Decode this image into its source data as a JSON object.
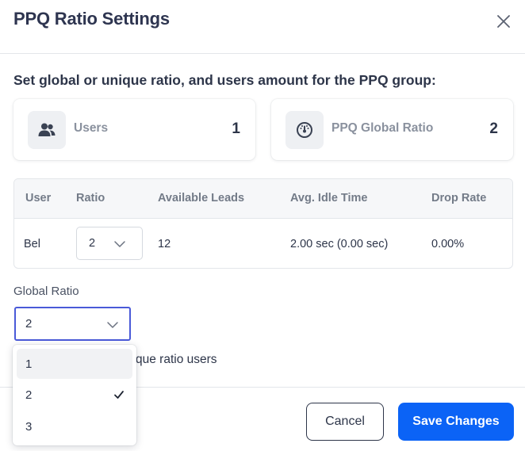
{
  "modal": {
    "title": "PPQ Ratio Settings",
    "subtitle": "Set global or unique ratio, and users amount for the PPQ group:"
  },
  "cards": {
    "users": {
      "label": "Users",
      "value": "1",
      "icon": "users-icon"
    },
    "ratio": {
      "label": "PPQ Global Ratio",
      "value": "2",
      "icon": "gauge-icon"
    }
  },
  "table": {
    "headers": [
      "User",
      "Ratio",
      "Available Leads",
      "Avg. Idle Time",
      "Drop Rate"
    ],
    "rows": [
      {
        "user": "Bel",
        "ratio": "2",
        "available_leads": "12",
        "avg_idle_time": "2.00 sec (0.00 sec)",
        "drop_rate": "0.00%"
      }
    ]
  },
  "global_ratio": {
    "label": "Global Ratio",
    "selected": "2",
    "options": [
      "1",
      "2",
      "3"
    ]
  },
  "unique_text": "que ratio users",
  "buttons": {
    "cancel": "Cancel",
    "save": "Save Changes"
  },
  "colors": {
    "primary": "#0b63f6",
    "focus_border": "#4a5ad8",
    "title": "#2e3550"
  }
}
